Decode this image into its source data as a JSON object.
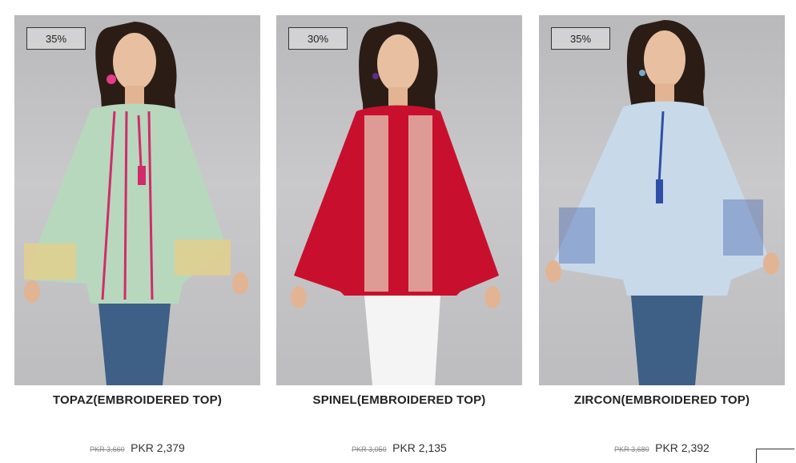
{
  "products": [
    {
      "discount": "35%",
      "title": "TOPAZ(EMBROIDERED TOP)",
      "old_price": "PKR 3,660",
      "new_price": "PKR 2,379",
      "colors": {
        "top": "#b7d8bd",
        "accent": "#d22b6a",
        "pants": "#3e5f86"
      }
    },
    {
      "discount": "30%",
      "title": "SPINEL(EMBROIDERED TOP)",
      "old_price": "PKR 3,050",
      "new_price": "PKR 2,135",
      "colors": {
        "top": "#c8102e",
        "accent": "#f0d6c8",
        "pants": "#f4f4f4"
      }
    },
    {
      "discount": "35%",
      "title": "ZIRCON(EMBROIDERED TOP)",
      "old_price": "PKR 3,680",
      "new_price": "PKR 2,392",
      "colors": {
        "top": "#c8d9ea",
        "accent": "#2f4fa6",
        "pants": "#3e5f86"
      }
    }
  ]
}
